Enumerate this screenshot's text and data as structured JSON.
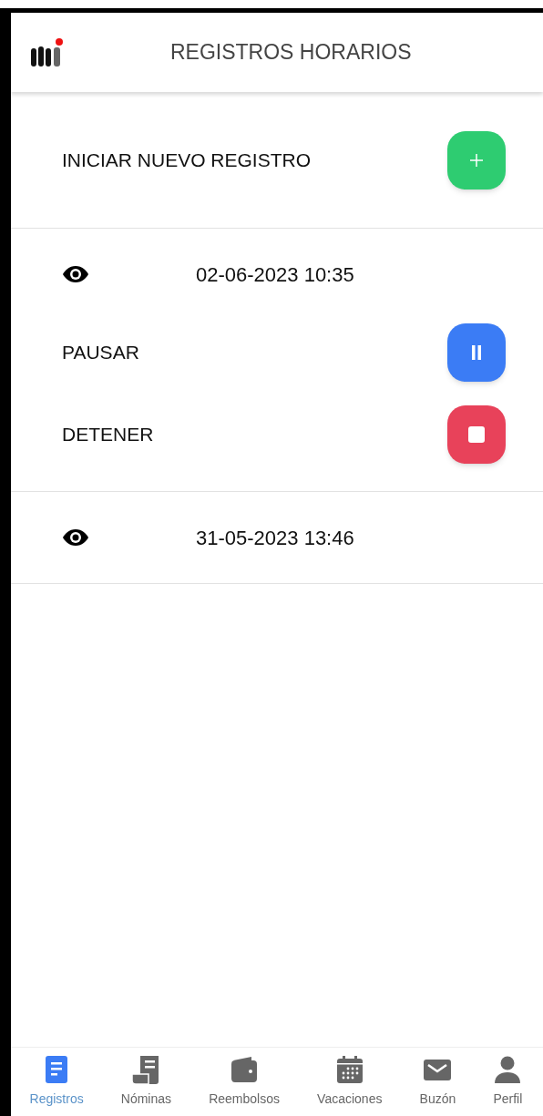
{
  "header": {
    "title": "REGISTROS HORARIOS"
  },
  "new_record": {
    "label": "INICIAR NUEVO REGISTRO"
  },
  "records": [
    {
      "datetime": "02-06-2023 10:35",
      "actions": [
        {
          "kind": "pause",
          "label": "PAUSAR"
        },
        {
          "kind": "stop",
          "label": "DETENER"
        }
      ]
    },
    {
      "datetime": "31-05-2023 13:46"
    }
  ],
  "nav": [
    {
      "kind": "doc",
      "label": "Registros",
      "selected": true
    },
    {
      "kind": "receipt",
      "label": "Nóminas",
      "selected": false
    },
    {
      "kind": "wallet",
      "label": "Reembolsos",
      "selected": false
    },
    {
      "kind": "calendar",
      "label": "Vacaciones",
      "selected": false
    },
    {
      "kind": "mail",
      "label": "Buzón",
      "selected": false
    },
    {
      "kind": "person",
      "label": "Perfil",
      "selected": false
    }
  ]
}
